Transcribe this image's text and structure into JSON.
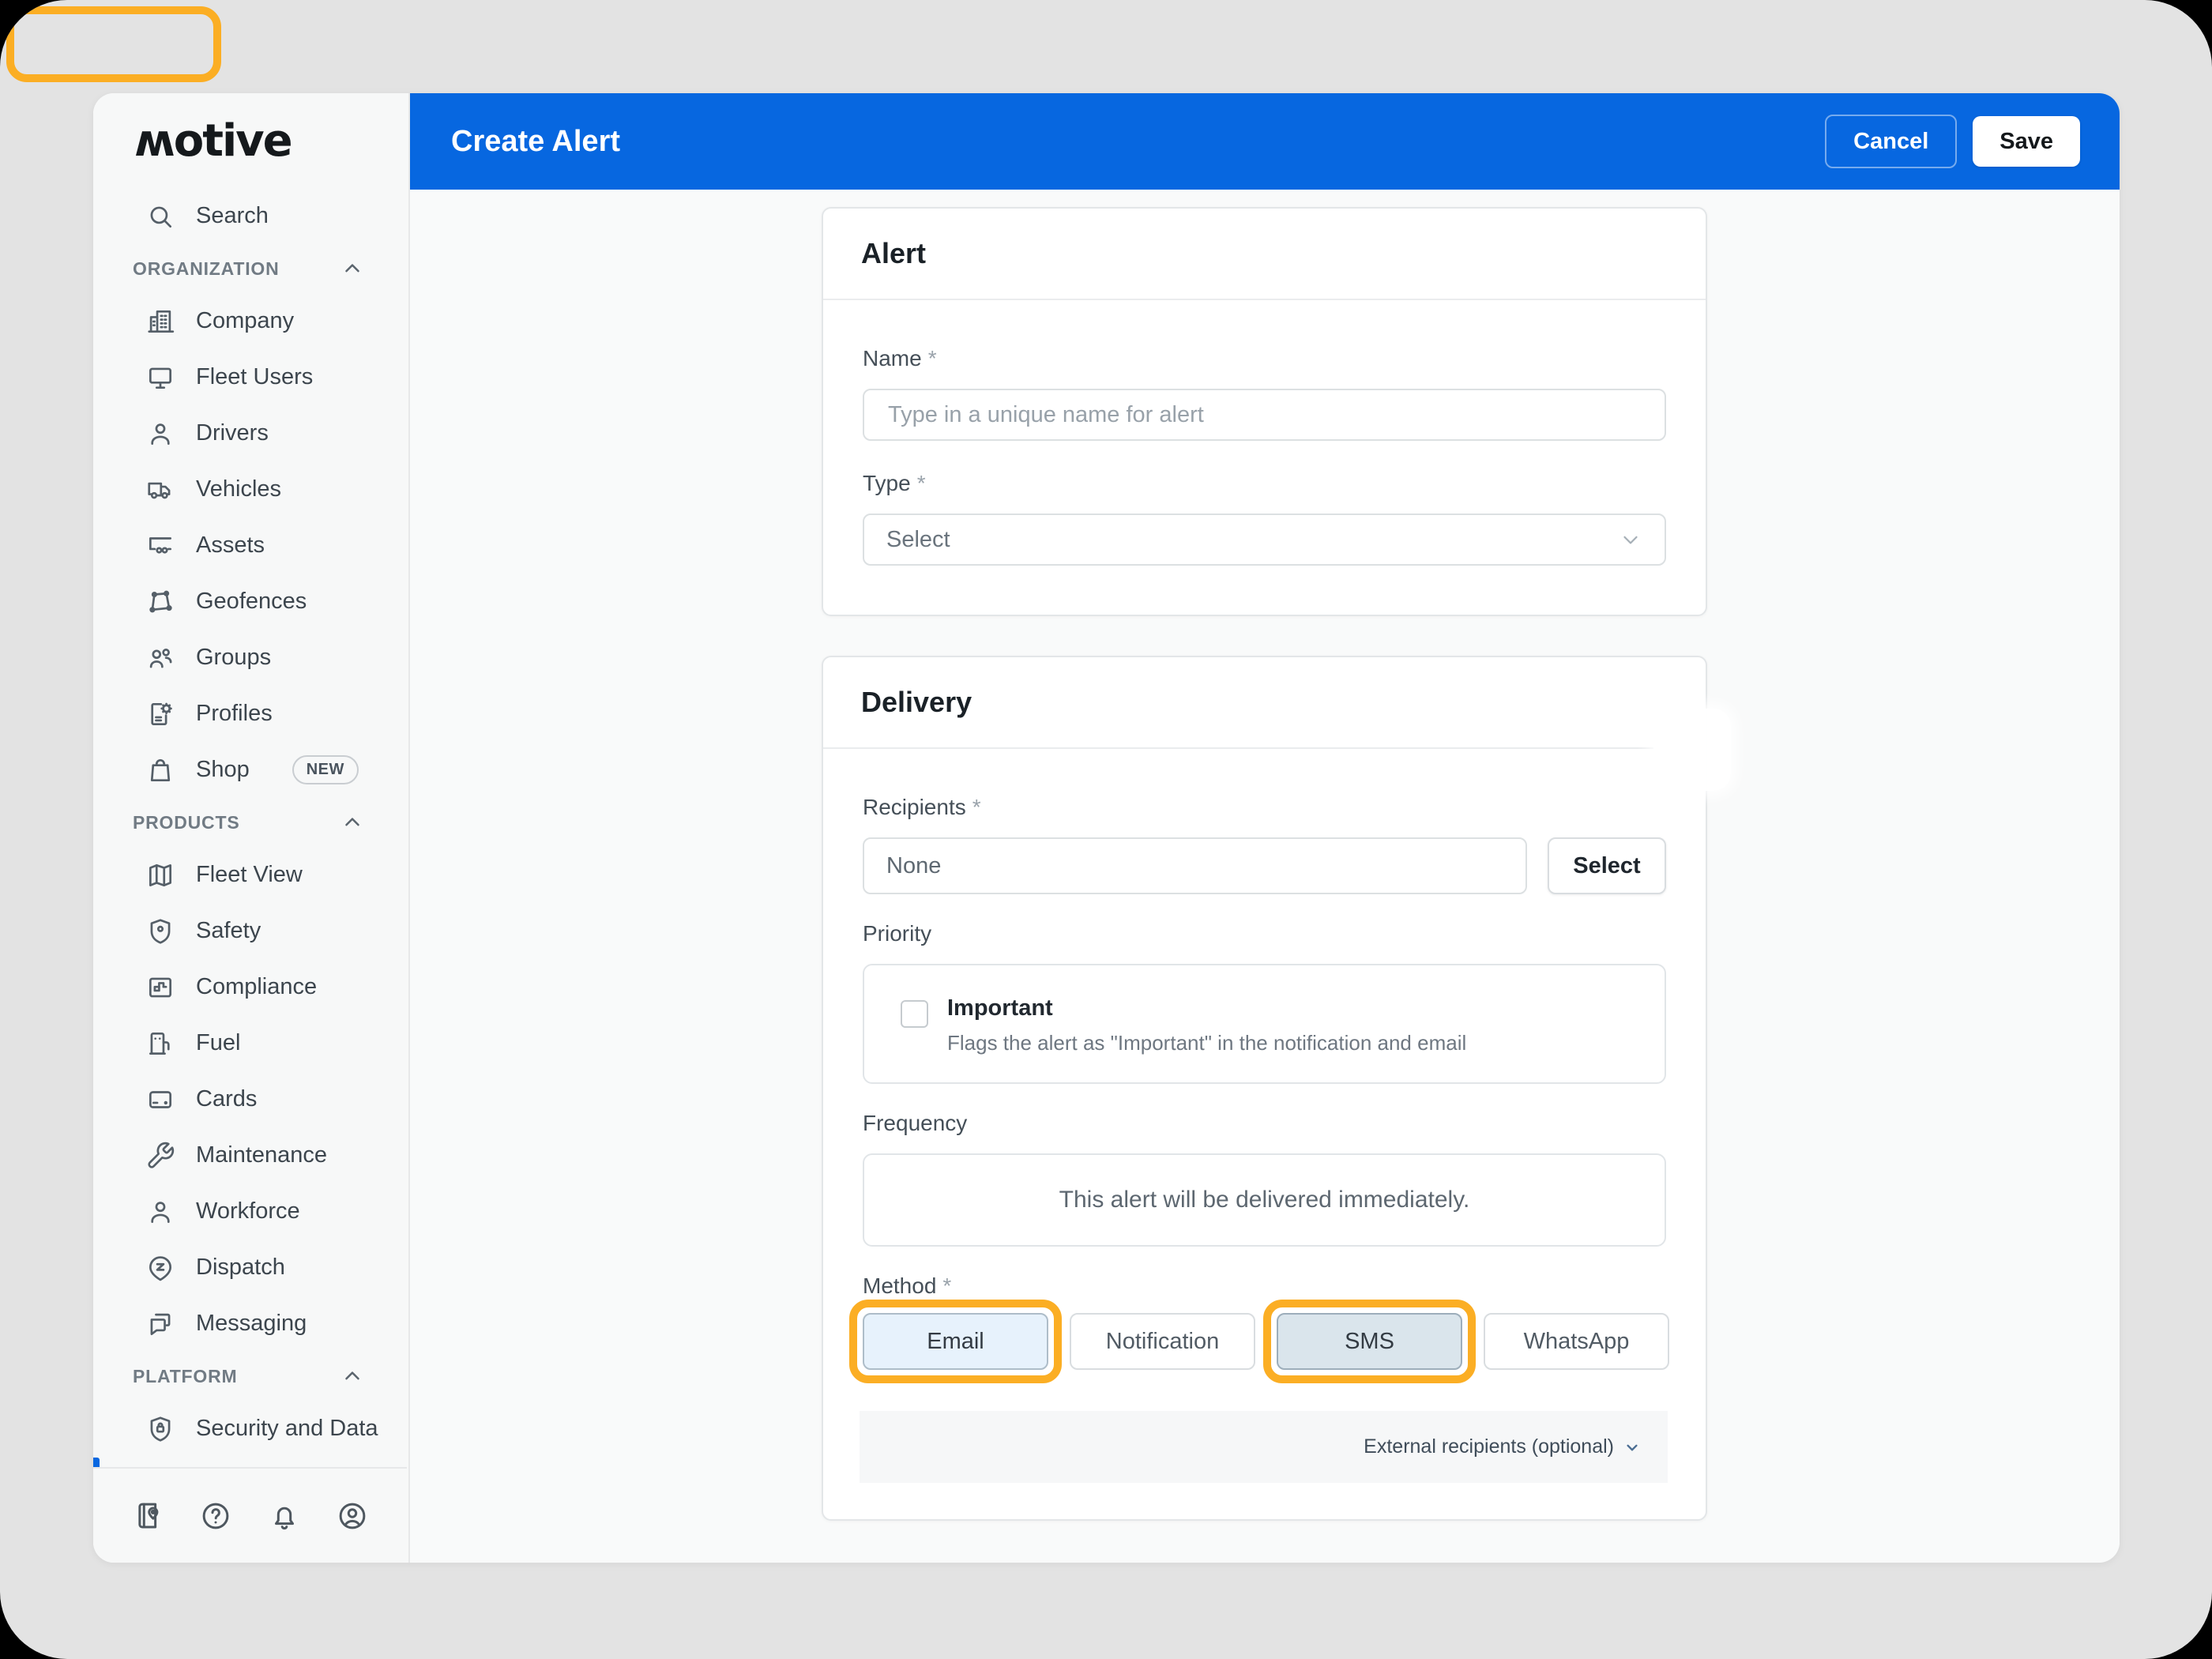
{
  "ui": {
    "required_mark": "*"
  },
  "colors": {
    "accent_blue": "#0767E0",
    "highlight_orange": "#FBAE24",
    "page_gray": "#E3E3E3",
    "email_fill": "#E7F2FC",
    "sms_fill": "#DAE5EC"
  },
  "sidebar": {
    "logo_text": "motive",
    "search": {
      "label": "Search",
      "icon": "search-icon"
    },
    "sections": [
      {
        "label": "ORGANIZATION",
        "chevron": "chevron-up-icon",
        "items": [
          {
            "label": "Company",
            "icon": "company-icon"
          },
          {
            "label": "Fleet Users",
            "icon": "monitor-icon"
          },
          {
            "label": "Drivers",
            "icon": "person-icon"
          },
          {
            "label": "Vehicles",
            "icon": "truck-icon"
          },
          {
            "label": "Assets",
            "icon": "trailer-icon"
          },
          {
            "label": "Geofences",
            "icon": "geofence-icon"
          },
          {
            "label": "Groups",
            "icon": "group-icon"
          },
          {
            "label": "Profiles",
            "icon": "profile-gear-icon"
          },
          {
            "label": "Shop",
            "icon": "shop-bag-icon",
            "badge": "NEW"
          }
        ]
      },
      {
        "label": "PRODUCTS",
        "chevron": "chevron-up-icon",
        "items": [
          {
            "label": "Fleet View",
            "icon": "map-icon"
          },
          {
            "label": "Safety",
            "icon": "shield-icon"
          },
          {
            "label": "Compliance",
            "icon": "compliance-icon"
          },
          {
            "label": "Fuel",
            "icon": "fuel-pump-icon"
          },
          {
            "label": "Cards",
            "icon": "credit-card-icon"
          },
          {
            "label": "Maintenance",
            "icon": "wrench-icon"
          },
          {
            "label": "Workforce",
            "icon": "person-icon"
          },
          {
            "label": "Dispatch",
            "icon": "dispatch-pin-icon"
          },
          {
            "label": "Messaging",
            "icon": "chat-icon"
          }
        ]
      },
      {
        "label": "PLATFORM",
        "chevron": "chevron-up-icon",
        "items": [
          {
            "label": "Security and Data",
            "icon": "shield-lock-icon"
          }
        ]
      }
    ],
    "footer_icons": [
      "logbook-icon",
      "help-icon",
      "bell-icon",
      "account-icon"
    ]
  },
  "header": {
    "title": "Create Alert",
    "cancel_label": "Cancel",
    "save_label": "Save"
  },
  "alert_card": {
    "title": "Alert",
    "name_label": "Name",
    "name_placeholder": "Type in a unique name for alert",
    "type_label": "Type",
    "type_value": "Select"
  },
  "delivery_card": {
    "title": "Delivery",
    "recipients_label": "Recipients",
    "recipients_value": "None",
    "select_button_label": "Select",
    "priority_label": "Priority",
    "important_label": "Important",
    "important_description": "Flags the alert as \"Important\" in the notification and email",
    "important_checked": false,
    "frequency_label": "Frequency",
    "frequency_text": "This alert will be delivered immediately.",
    "method_label": "Method",
    "methods": [
      {
        "label": "Email",
        "selected": true,
        "highlighted": true,
        "fill": "#E7F2FC",
        "border": "#AEBDC9"
      },
      {
        "label": "Notification",
        "selected": false,
        "highlighted": false,
        "fill": "#FFFFFF",
        "border": "#D9DDE0"
      },
      {
        "label": "SMS",
        "selected": true,
        "highlighted": true,
        "fill": "#DAE5EC",
        "border": "#9DAEBB"
      },
      {
        "label": "WhatsApp",
        "selected": false,
        "highlighted": false,
        "fill": "#FFFFFF",
        "border": "#D9DDE0"
      }
    ],
    "external_recipients_label": "External recipients (optional)"
  }
}
